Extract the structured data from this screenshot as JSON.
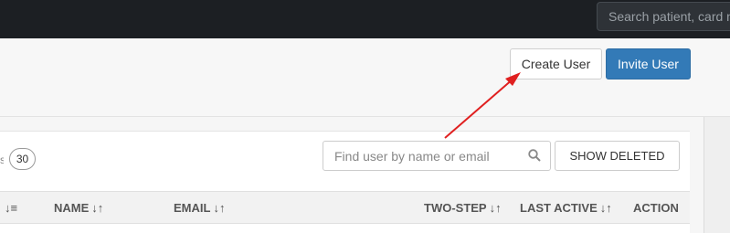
{
  "topbar": {
    "search_placeholder": "Search patient, card n"
  },
  "header": {
    "create_user_label": "Create User",
    "invite_user_label": "Invite User"
  },
  "toolbar": {
    "count": "30",
    "search_placeholder": "Find user by name or email",
    "show_deleted_label": "SHOW DELETED"
  },
  "table": {
    "columns": [
      {
        "label": "",
        "sort_icon": "↓≡"
      },
      {
        "label": "NAME",
        "sort_icon": "↓↑"
      },
      {
        "label": "EMAIL",
        "sort_icon": "↓↑"
      },
      {
        "label": "TWO-STEP",
        "sort_icon": "↓↑"
      },
      {
        "label": "LAST ACTIVE",
        "sort_icon": "↓↑"
      },
      {
        "label": "ACTION",
        "sort_icon": ""
      }
    ]
  },
  "colors": {
    "topbar": "#1c1f23",
    "primary": "#337ab7",
    "annotation_arrow": "#e02020"
  },
  "icons": {
    "search": "search-icon",
    "sort": "sort-icon",
    "annotation": "annotation-arrow-icon"
  }
}
